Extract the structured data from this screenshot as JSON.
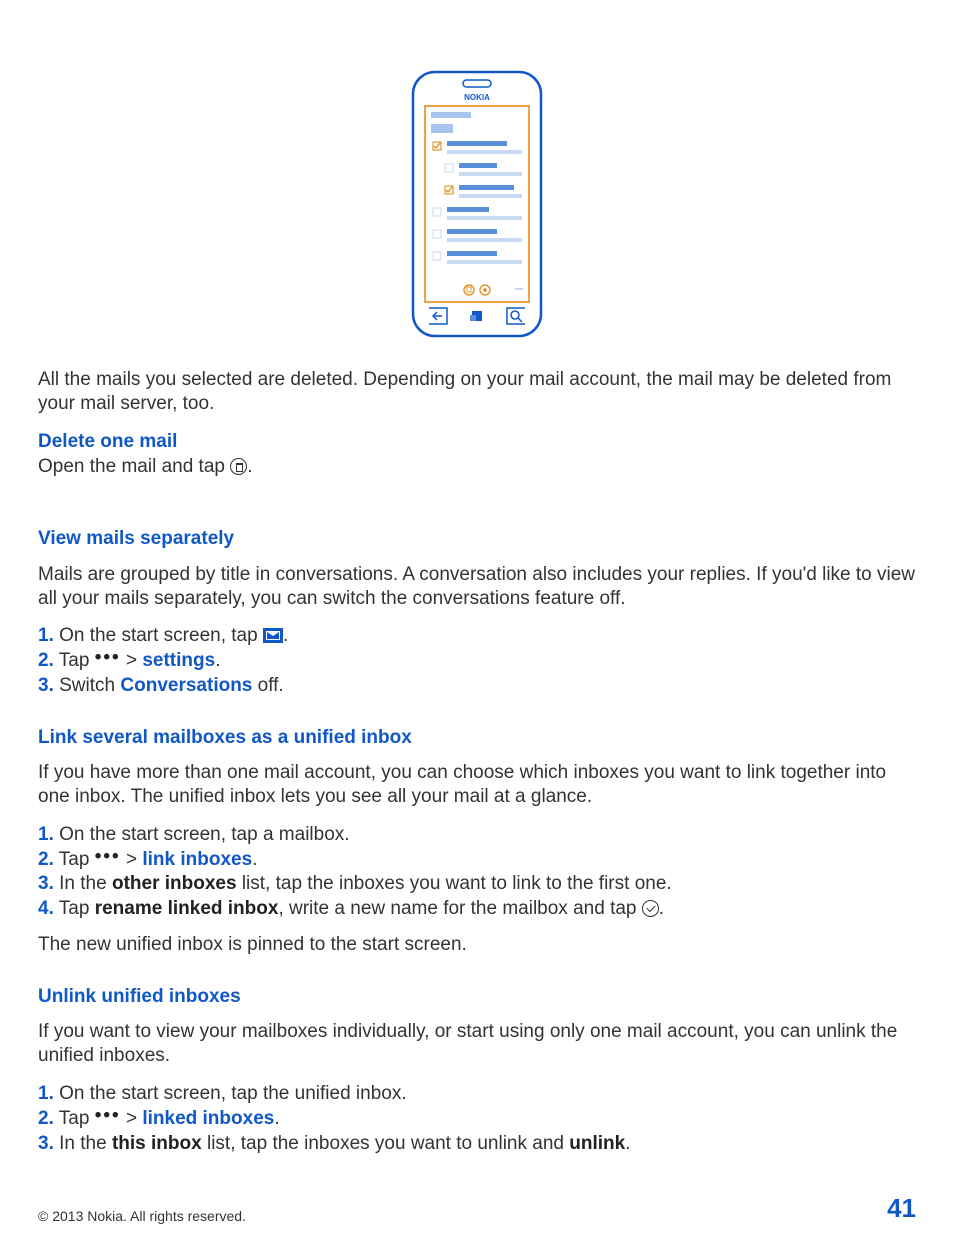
{
  "illustration": {
    "brand": "NOKIA"
  },
  "para_deleted": "All the mails you selected are deleted. Depending on your mail account, the mail may be deleted from your mail server, too.",
  "delete_one": {
    "heading": "Delete one mail",
    "text_before": "Open the mail and tap ",
    "text_after": "."
  },
  "view_separately": {
    "heading": "View mails separately",
    "para": "Mails are grouped by title in conversations. A conversation also includes your replies. If you'd like to view all your mails separately, you can switch the conversations feature off.",
    "step1_num": "1.",
    "step1_before": " On the start screen, tap ",
    "step1_after": ".",
    "step2_num": "2.",
    "step2_before": " Tap  ",
    "step2_arrow": " > ",
    "step2_settings": "settings",
    "step2_after": ".",
    "step3_num": "3.",
    "step3_before": " Switch ",
    "step3_conv": "Conversations",
    "step3_after": " off."
  },
  "link_inboxes": {
    "heading": "Link several mailboxes as a unified inbox",
    "para": "If you have more than one mail account, you can choose which inboxes you want to link together into one inbox. The unified inbox lets you see all your mail at a glance.",
    "step1_num": "1.",
    "step1_text": " On the start screen, tap a mailbox.",
    "step2_num": "2.",
    "step2_before": " Tap  ",
    "step2_arrow": " > ",
    "step2_link": "link inboxes",
    "step2_after": ".",
    "step3_num": "3.",
    "step3_before": " In the ",
    "step3_other": "other inboxes",
    "step3_after": " list, tap the inboxes you want to link to the first one.",
    "step4_num": "4.",
    "step4_before": " Tap ",
    "step4_rename": "rename linked inbox",
    "step4_mid": ", write a new name for the mailbox and tap ",
    "step4_after": ".",
    "para_after": "The new unified inbox is pinned to the start screen."
  },
  "unlink": {
    "heading": "Unlink unified inboxes",
    "para": "If you want to view your mailboxes individually, or start using only one mail account, you can unlink the unified inboxes.",
    "step1_num": "1.",
    "step1_text": " On the start screen, tap the unified inbox.",
    "step2_num": "2.",
    "step2_before": " Tap  ",
    "step2_arrow": " > ",
    "step2_linked": "linked inboxes",
    "step2_after": ".",
    "step3_num": "3.",
    "step3_before": " In the ",
    "step3_this": "this inbox",
    "step3_mid": " list, tap the inboxes you want to unlink and ",
    "step3_unlink": "unlink",
    "step3_after": "."
  },
  "footer": {
    "copyright": "© 2013 Nokia. All rights reserved.",
    "page": "41"
  },
  "dots_glyph": "•••"
}
